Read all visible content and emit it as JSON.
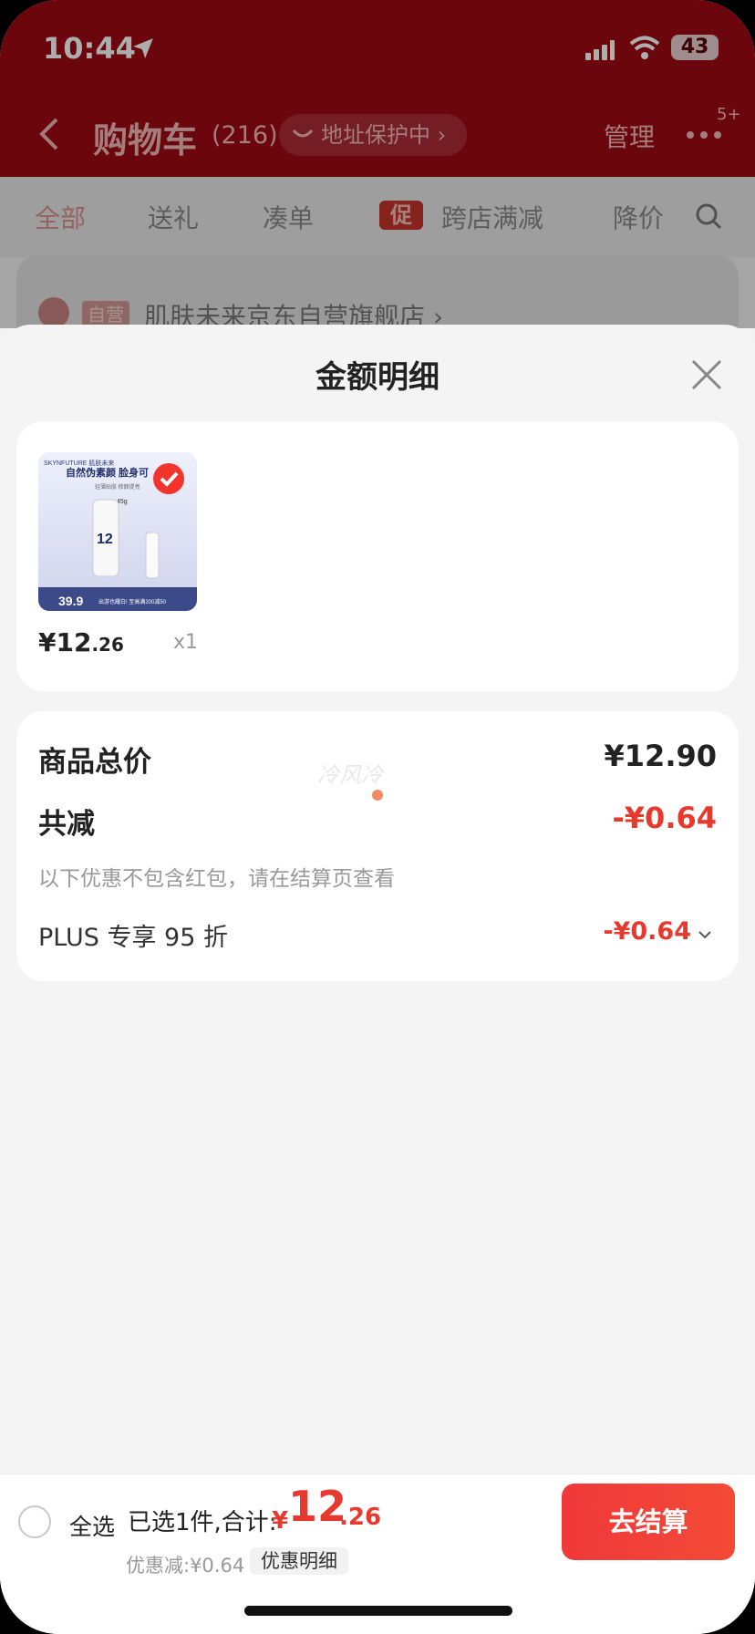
{
  "status_bar": {
    "time": "10:44",
    "battery": "43"
  },
  "nav": {
    "title": "购物车",
    "count": "(216)",
    "address_pill": "地址保护中 ›",
    "manage": "管理",
    "more_badge": "5+"
  },
  "tabs": [
    {
      "label": "全部"
    },
    {
      "label": "送礼"
    },
    {
      "label": "凑单"
    },
    {
      "label": "跨店满减"
    },
    {
      "label": "降价"
    }
  ],
  "promo_tag": "促",
  "store": {
    "tag": "自营",
    "name": "肌肤未来京东自营旗舰店 ›"
  },
  "sheet": {
    "title": "金额明细",
    "product": {
      "image_text": {
        "brand": "SKYNFUTURE 肌肤未来",
        "headline": "自然伪素颜 脸身可",
        "sub": "轻薄贴肤 修颜提亮",
        "weight": "45g",
        "number": "12",
        "price_badge": "39.9",
        "bottom_line": "出游也耀白! 至高满200减50"
      },
      "price_int": "¥12",
      "price_dec": ".26",
      "qty": "x1"
    },
    "summary": {
      "total_label": "商品总价",
      "total_value": "¥12.90",
      "reduce_label": "共减",
      "reduce_value": "-¥0.64",
      "note": "以下优惠不包含红包，请在结算页查看",
      "plus_label": "PLUS 专享 95 折",
      "plus_value": "-¥0.64",
      "watermark": "冷风冷"
    }
  },
  "bottom": {
    "select_all": "全选",
    "selected_text": "已选1件,合计:",
    "currency": "¥",
    "total_int": "12",
    "total_dec": ".26",
    "discount": "优惠减:¥0.64",
    "detail_button": "优惠明细",
    "checkout_button": "去结算"
  },
  "colors": {
    "accent": "#e8392f",
    "header_bg": "#9e0a14"
  }
}
